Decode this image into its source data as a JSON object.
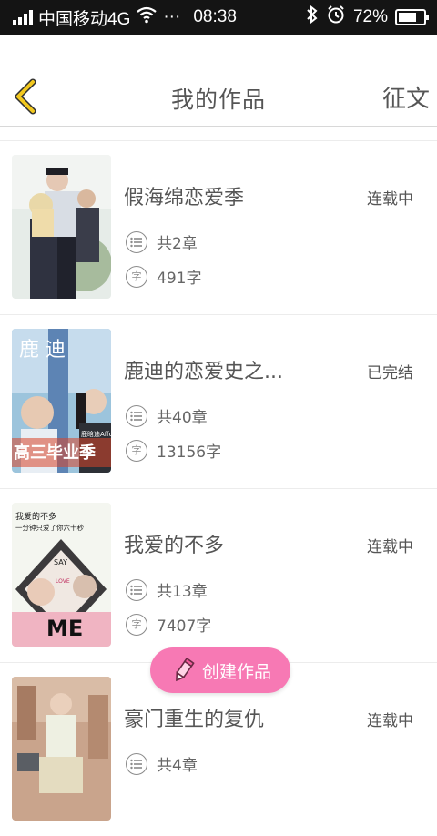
{
  "status_bar": {
    "carrier": "中国移动4G",
    "more": "···",
    "time": "08:38",
    "battery": "72%",
    "battery_level": 0.72,
    "icons": [
      "signal-icon",
      "wifi-icon",
      "bluetooth-icon",
      "alarm-icon",
      "battery-icon"
    ]
  },
  "header": {
    "back_icon": "chevron-left-icon",
    "title": "我的作品",
    "contest_label": "征文"
  },
  "works": [
    {
      "title": "假海绵恋爱季",
      "status": "连载中",
      "chapters": "共2章",
      "words": "491字"
    },
    {
      "title": "鹿迪的恋爱史之...",
      "status": "已完结",
      "chapters": "共40章",
      "words": "13156字"
    },
    {
      "title": "我爱的不多",
      "status": "连载中",
      "chapters": "共13章",
      "words": "7407字"
    },
    {
      "title": "豪门重生的复仇",
      "status": "连载中",
      "chapters": "共4章",
      "words": ""
    }
  ],
  "cover_texts": {
    "cover2_top": "鹿   迪",
    "cover2_badge": "鹿晗迪Affce",
    "cover2_bottom": "高三毕业季",
    "cover3_line1": "我爱的不多",
    "cover3_line2": "一分钟只爱了你六十秒",
    "cover3_say": "SAY",
    "cover3_love": "LOVE",
    "cover3_me": "ME"
  },
  "words_icon_glyph": "字",
  "fab": {
    "label": "创建作品",
    "icon": "pencil-icon"
  },
  "colors": {
    "accent_yellow": "#f2c81e",
    "fab_pink": "#f779b4",
    "statusbar_bg": "#141414"
  }
}
